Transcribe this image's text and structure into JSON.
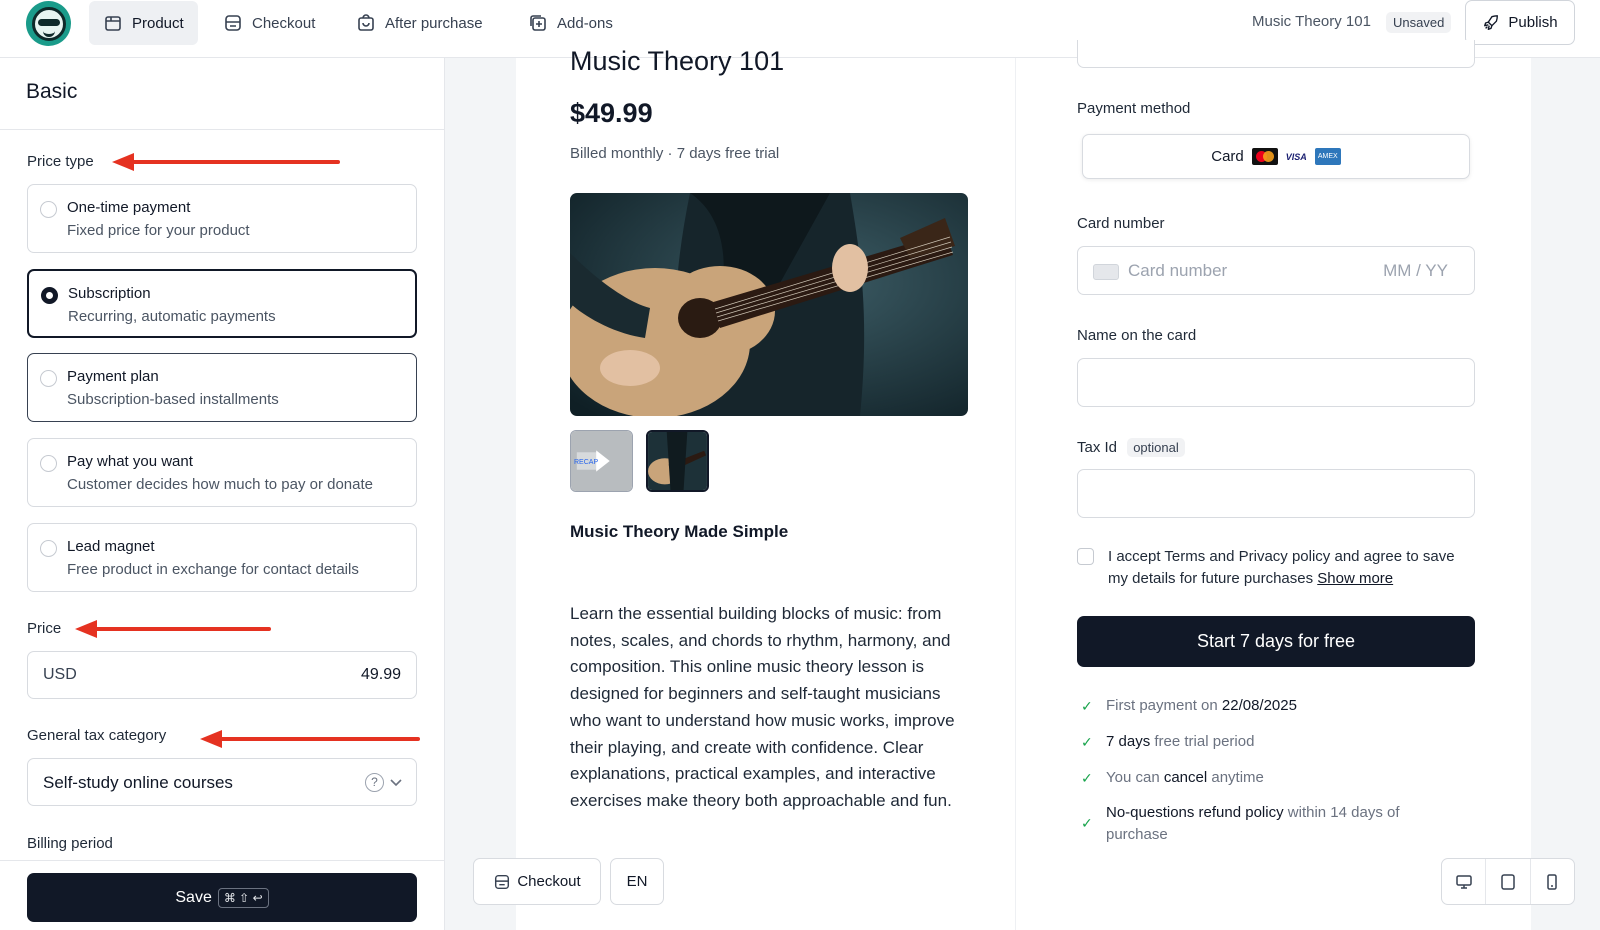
{
  "topbar": {
    "tabs": [
      {
        "label": "Product",
        "icon": "package-icon"
      },
      {
        "label": "Checkout",
        "icon": "checkout-icon"
      },
      {
        "label": "After purchase",
        "icon": "bag-icon"
      },
      {
        "label": "Add-ons",
        "icon": "plus-box-icon"
      }
    ],
    "project_name": "Music Theory 101",
    "status_badge": "Unsaved",
    "publish_label": "Publish"
  },
  "left": {
    "title": "Basic",
    "price_type_label": "Price type",
    "options": [
      {
        "title": "One-time payment",
        "subtitle": "Fixed price for your product",
        "selected": false
      },
      {
        "title": "Subscription",
        "subtitle": "Recurring, automatic payments",
        "selected": true
      },
      {
        "title": "Payment plan",
        "subtitle": "Subscription-based installments",
        "selected": false
      },
      {
        "title": "Pay what you want",
        "subtitle": "Customer decides how much to pay or donate",
        "selected": false
      },
      {
        "title": "Lead magnet",
        "subtitle": "Free product in exchange for contact details",
        "selected": false
      }
    ],
    "price_label": "Price",
    "price_currency": "USD",
    "price_value": "49.99",
    "tax_label": "General tax category",
    "tax_value": "Self-study online courses",
    "tax_help": "?",
    "billing_label": "Billing period",
    "save_label": "Save",
    "save_shortcut": "⌘ ⇧ ↩"
  },
  "preview": {
    "title": "Music Theory 101",
    "price": "$49.99",
    "billing_note": "Billed monthly · 7 days free trial",
    "thumb_caption": "RECAP",
    "subtitle": "Music Theory Made Simple",
    "description": "Learn the essential building blocks of music: from notes, scales, and chords to rhythm, harmony, and composition. This online music theory lesson is designed for beginners and self-taught musicians who want to understand how music works, improve their playing, and create with confidence. Clear explanations, practical examples, and interactive exercises make theory both approachable and fun.",
    "checkout_btn": "Checkout",
    "lang_btn": "EN"
  },
  "form": {
    "payment_method_label": "Payment method",
    "payment_method_value": "Card",
    "card_brand_visa": "VISA",
    "card_brand_amex": "AMEX",
    "card_number_label": "Card number",
    "card_number_placeholder": "Card number",
    "expiry_placeholder": "MM / YY",
    "name_label": "Name on the card",
    "tax_id_label": "Tax Id",
    "tax_id_badge": "optional",
    "terms_text": "I accept Terms and Privacy policy and agree to save my details for future purchases",
    "show_more": "Show more",
    "cta": "Start 7 days for free",
    "perks": [
      {
        "pre": "First payment on ",
        "strong": "22/08/2025",
        "post": ""
      },
      {
        "pre": "",
        "strong": "7 days",
        "post": " free trial period"
      },
      {
        "pre": "You can ",
        "strong": "cancel",
        "post": " anytime"
      },
      {
        "pre": "",
        "strong": "No-questions refund policy",
        "post": " within 14 days of purchase"
      }
    ]
  },
  "colors": {
    "accent_dark": "#111827",
    "annotation_arrow": "#e53221",
    "check_green": "#16a34a",
    "logo_teal": "#1a9b8a"
  }
}
